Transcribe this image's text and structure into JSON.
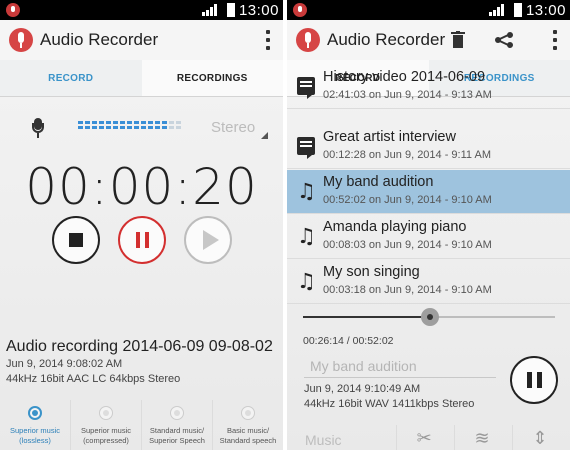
{
  "left": {
    "status": {
      "time": "13:00"
    },
    "app_title": "Audio Recorder",
    "tabs": [
      {
        "label": "RECORD"
      },
      {
        "label": "RECORDINGS"
      }
    ],
    "quality_label": "Stereo",
    "timer": "00:00:20",
    "recording": {
      "name": "Audio recording 2014-06-09 09-08-02",
      "date": "Jun 9, 2014 9:08:02 AM",
      "format": "44kHz 16bit AAC LC 64kbps Stereo"
    },
    "quality_options": [
      {
        "line1": "Superior music",
        "line2": "(lossless)",
        "selected": true
      },
      {
        "line1": "Superior music",
        "line2": "(compressed)",
        "selected": false
      },
      {
        "line1": "Standard music/",
        "line2": "Superior Speech",
        "selected": false
      },
      {
        "line1": "Basic music/",
        "line2": "Standard speech",
        "selected": false
      }
    ],
    "icons": [
      "mic-status-icon",
      "signal-icon",
      "battery-icon",
      "app-mic-icon",
      "overflow-menu-icon",
      "microphone-icon",
      "dropdown-arrow-icon",
      "stop-icon",
      "pause-icon",
      "play-icon"
    ]
  },
  "right": {
    "status": {
      "time": "13:00"
    },
    "app_title": "Audio Recorder",
    "tabs": [
      {
        "label": "RECORD"
      },
      {
        "label": "RECORDINGS"
      }
    ],
    "recordings": [
      {
        "title": "History video 2014-06-09",
        "meta": "02:41:03 on Jun 9, 2014 - 9:13 AM",
        "icon": "comment-icon",
        "selected": false
      },
      {
        "title": "Great artist interview",
        "meta": "00:12:28 on Jun 9, 2014 - 9:11 AM",
        "icon": "comment-icon",
        "selected": false
      },
      {
        "title": "My band audition",
        "meta": "00:52:02 on Jun 9, 2014 - 9:10 AM",
        "icon": "music-note-icon",
        "selected": true
      },
      {
        "title": "Amanda playing piano",
        "meta": "00:08:03 on Jun 9, 2014 - 9:10 AM",
        "icon": "music-note-icon",
        "selected": false
      },
      {
        "title": "My son singing",
        "meta": "00:03:18 on Jun 9, 2014 - 9:10 AM",
        "icon": "music-note-icon",
        "selected": false
      }
    ],
    "playback": {
      "position": "00:26:14 / 00:52:02",
      "progress": 0.504,
      "name": "My band audition",
      "date": "Jun 9, 2014 9:10:49 AM",
      "format": "44kHz 16bit WAV 1411kbps Stereo"
    },
    "tools": [
      {
        "label": "Music"
      }
    ],
    "icons": [
      "delete-icon",
      "share-icon",
      "overflow-menu-icon",
      "pause-icon",
      "scissors-icon",
      "wave-icon",
      "expand-icon"
    ]
  },
  "colors": {
    "accent": "#3a93c9",
    "record_red": "#d32f2f",
    "selection": "#9ec3de"
  }
}
